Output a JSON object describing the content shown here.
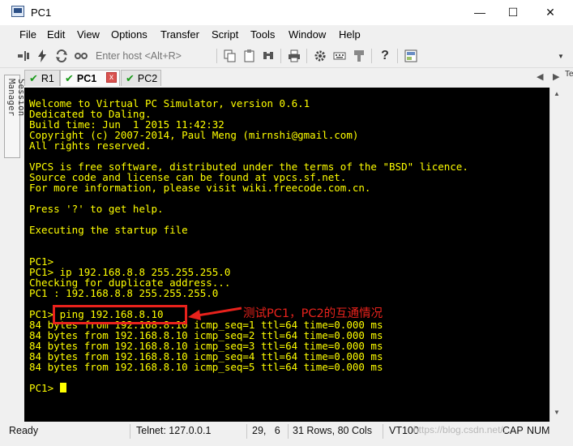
{
  "window": {
    "title": "PC1",
    "minimize": "—",
    "maximize": "☐",
    "close": "✕"
  },
  "menu": [
    "File",
    "Edit",
    "View",
    "Options",
    "Transfer",
    "Script",
    "Tools",
    "Window",
    "Help"
  ],
  "toolbar": {
    "host_placeholder": "Enter host <Alt+R>"
  },
  "session_manager": {
    "label": "Session Manager"
  },
  "tabs": [
    {
      "label": "R1",
      "status": "connected"
    },
    {
      "label": "PC1",
      "status": "connected",
      "active": true
    },
    {
      "label": "PC2",
      "status": "connected"
    }
  ],
  "tab_close": "x",
  "right_sliver": "Te",
  "terminal": {
    "lines": [
      "Welcome to Virtual PC Simulator, version 0.6.1",
      "Dedicated to Daling.",
      "Build time: Jun  1 2015 11:42:32",
      "Copyright (c) 2007-2014, Paul Meng (mirnshi@gmail.com)",
      "All rights reserved.",
      "",
      "VPCS is free software, distributed under the terms of the \"BSD\" licence.",
      "Source code and license can be found at vpcs.sf.net.",
      "For more information, please visit wiki.freecode.com.cn.",
      "",
      "Press '?' to get help.",
      "",
      "Executing the startup file",
      "",
      "",
      "PC1>",
      "PC1> ip 192.168.8.8 255.255.255.0",
      "Checking for duplicate address...",
      "PC1 : 192.168.8.8 255.255.255.0",
      "",
      "PC1> ping 192.168.8.10",
      "84 bytes from 192.168.8.10 icmp_seq=1 ttl=64 time=0.000 ms",
      "84 bytes from 192.168.8.10 icmp_seq=2 ttl=64 time=0.000 ms",
      "84 bytes from 192.168.8.10 icmp_seq=3 ttl=64 time=0.000 ms",
      "84 bytes from 192.168.8.10 icmp_seq=4 ttl=64 time=0.000 ms",
      "84 bytes from 192.168.8.10 icmp_seq=5 ttl=64 time=0.000 ms",
      ""
    ],
    "prompt": "PC1> ",
    "text_color": "#ffff00",
    "background": "#000000"
  },
  "annotation": {
    "text": "测试PC1，PC2的互通情况",
    "color": "#e8221c"
  },
  "status": {
    "ready": "Ready",
    "connection": "Telnet: 127.0.0.1",
    "cursor_pos": "29,   6",
    "size": "31 Rows, 80 Cols",
    "terminal_type": "VT100",
    "caps": "CAP",
    "num": "NUM"
  },
  "watermark": "https://blog.csdn.net/..."
}
